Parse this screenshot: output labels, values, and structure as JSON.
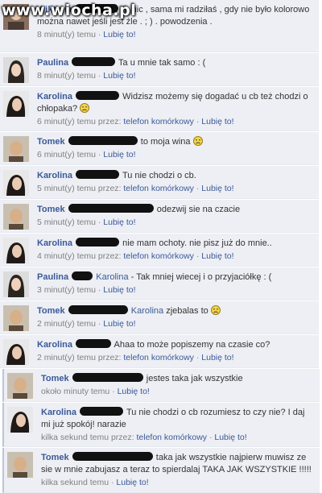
{
  "watermark": "www.wiocha.pl",
  "like_label": "Lubię to!",
  "comments": [
    {
      "author": "Wiktoria",
      "text": "to nic , sama mi radziłaś , gdy nie było kolorowo można nawet jeśli jest źle . ; ) . powodzenia .",
      "time": "8 minut(y) temu",
      "via": ""
    },
    {
      "author": "Paulina",
      "text": "Ta u mnie tak samo : (",
      "time": "8 minut(y) temu",
      "via": ""
    },
    {
      "author": "Karolina",
      "text": "Widzisz możemy się dogadać u cb też chodzi o chłopaka?",
      "time": "6 minut(y) temu przez:",
      "via": "telefon komórkowy"
    },
    {
      "author": "Tomek",
      "text": "to moja wina",
      "time": "6 minut(y) temu",
      "via": ""
    },
    {
      "author": "Karolina",
      "text": "Tu nie chodzi o cb.",
      "time": "5 minut(y) temu przez:",
      "via": "telefon komórkowy"
    },
    {
      "author": "Tomek",
      "text": "odezwij sie na czacie",
      "time": "5 minut(y) temu",
      "via": ""
    },
    {
      "author": "Karolina",
      "text": "nie mam ochoty. nie pisz już do mnie..",
      "time": "4 minut(y) temu przez:",
      "via": "telefon komórkowy"
    },
    {
      "author": "Paulina",
      "mention": "Karolina",
      "text": "- Tak mniej wiecej i o przyjaciółkę : (",
      "time": "3 minut(y) temu",
      "via": ""
    },
    {
      "author": "Tomek",
      "mention": "Karolina",
      "text": "zjebalas to",
      "time": "2 minut(y) temu",
      "via": ""
    },
    {
      "author": "Karolina",
      "text": "Ahaa to może popiszemy na czasie co?",
      "time": "2 minut(y) temu przez:",
      "via": "telefon komórkowy"
    },
    {
      "author": "Tomek",
      "text": "jestes taka jak wszystkie",
      "time": "około minuty temu",
      "via": ""
    },
    {
      "author": "Karolina",
      "text": "Tu nie chodzi o cb rozumiesz to czy nie? I daj mi już spokój! narazie",
      "time": "kilka sekund temu przez:",
      "via": "telefon komórkowy"
    },
    {
      "author": "Tomek",
      "text": "taka jak wszystkie najpierw muwisz ze sie w mnie zabujasz a teraz to spierdalaj TAKA JAK WSZYSTKIE !!!!!",
      "time": "kilka sekund temu",
      "via": ""
    }
  ]
}
